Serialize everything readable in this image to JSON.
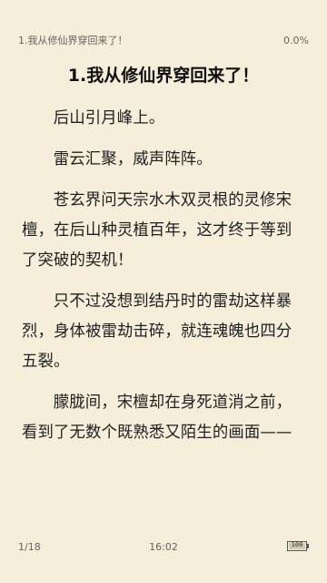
{
  "header": {
    "chapter_short": "1.我从修仙界穿回来了！",
    "progress": "0.0%"
  },
  "chapter": {
    "title": "1.我从修仙界穿回来了！",
    "paragraphs": [
      "后山引月峰上。",
      "雷云汇聚，威声阵阵。",
      "苍玄界问天宗水木双灵根的灵修宋檀，在后山种灵植百年，这才终于等到了突破的契机！",
      "只不过没想到结丹时的雷劫这样暴烈，身体被雷劫击碎，就连魂魄也四分五裂。",
      "朦胧间，宋檀却在身死道消之前，看到了无数个既熟悉又陌生的画面——"
    ]
  },
  "footer": {
    "page": "1/18",
    "time": "16:02",
    "battery": "100",
    "battery_level": 1.0,
    "battery_icon": "battery-icon"
  },
  "colors": {
    "background": "#f5eedb",
    "text": "#1f1f1f",
    "muted": "#6b655a"
  }
}
